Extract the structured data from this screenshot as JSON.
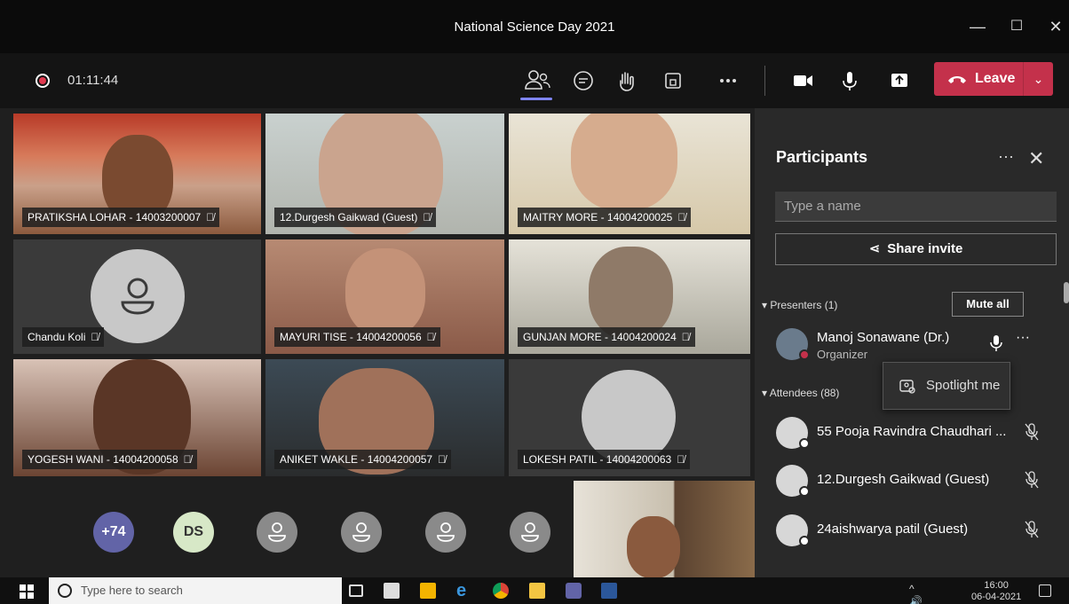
{
  "window": {
    "title": "National Science Day 2021",
    "minimize": "—",
    "maximize": "☐",
    "close": "✕"
  },
  "toolbar": {
    "recording_time": "01:11:44",
    "leave_label": "Leave",
    "leave_caret": "⌄",
    "tools": [
      "participants-icon",
      "chat-icon",
      "raise-hand-icon",
      "breakout-icon",
      "more-icon",
      "camera-icon",
      "mic-icon",
      "share-icon"
    ]
  },
  "tiles": [
    {
      "name": "PRATIKSHA LOHAR - 14003200007"
    },
    {
      "name": "12.Durgesh Gaikwad (Guest)"
    },
    {
      "name": "MAITRY MORE - 14004200025"
    },
    {
      "name": "Chandu Koli"
    },
    {
      "name": "MAYURI TISE - 14004200056"
    },
    {
      "name": "GUNJAN MORE - 14004200024"
    },
    {
      "name": "YOGESH WANI - 14004200058"
    },
    {
      "name": "ANIKET WAKLE - 14004200057"
    },
    {
      "name": "LOKESH PATIL - 14004200063"
    }
  ],
  "bottom_row": {
    "overflow_count": "+74",
    "initials": "DS"
  },
  "panel": {
    "title": "Participants",
    "more": "···",
    "close": "✕",
    "search_placeholder": "Type a name",
    "share_invite": "Share invite",
    "presenters_label": "Presenters (1)",
    "mute_all": "Mute all",
    "presenter": {
      "name": "Manoj Sonawane (Dr.)",
      "role": "Organizer"
    },
    "attendees_label": "Attendees (88)",
    "attendees": [
      "55 Pooja Ravindra Chaudhari ...",
      "12.Durgesh Gaikwad (Guest)",
      "24aishwarya patil (Guest)"
    ],
    "popup_spotlight": "Spotlight me"
  },
  "taskbar": {
    "search_placeholder": "Type here to search",
    "time": "16:00",
    "date": "06-04-2021"
  },
  "colors": {
    "leave": "#c4314b",
    "accent": "#7f85f5",
    "record": "#e03a50"
  }
}
